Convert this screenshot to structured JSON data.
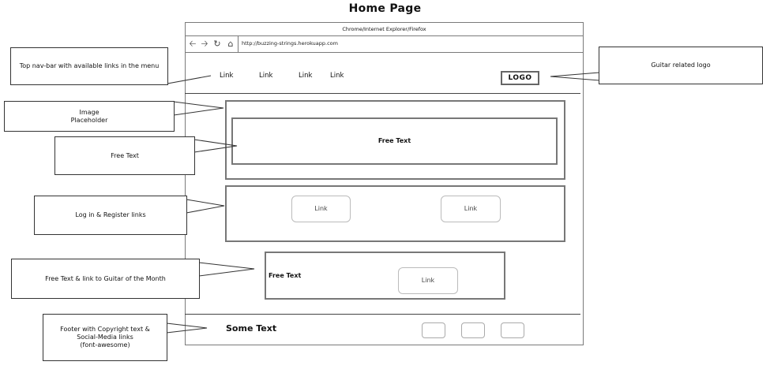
{
  "page_title": "Home Page",
  "browser": {
    "title": "Chrome/Internet Explorer/Firefox",
    "url": "http://buzzing-strings.herokuapp.com",
    "nav_icons": [
      "back-arrow-icon",
      "forward-arrow-icon",
      "refresh-icon",
      "home-icon"
    ]
  },
  "nav": {
    "links": [
      "Link",
      "Link",
      "Link",
      "Link"
    ],
    "logo": "LOGO"
  },
  "hero": {
    "free_text": "Free Text"
  },
  "auth": {
    "links": [
      "Link",
      "Link"
    ]
  },
  "guitar_of_month": {
    "text": "Free Text",
    "link": "Link"
  },
  "footer": {
    "text": "Some Text",
    "social_icons": 3
  },
  "callouts": {
    "nav": "Top nav-bar with available links in the menu",
    "logo": "Guitar related logo",
    "image": [
      "Image",
      "Placeholder"
    ],
    "free_text": "Free Text",
    "login": "Log in & Register links",
    "gotm": "Free Text & link to Guitar of the Month",
    "footer": [
      "Footer with Copyright text &",
      "Social-Media links",
      "(font-awesome)"
    ]
  }
}
